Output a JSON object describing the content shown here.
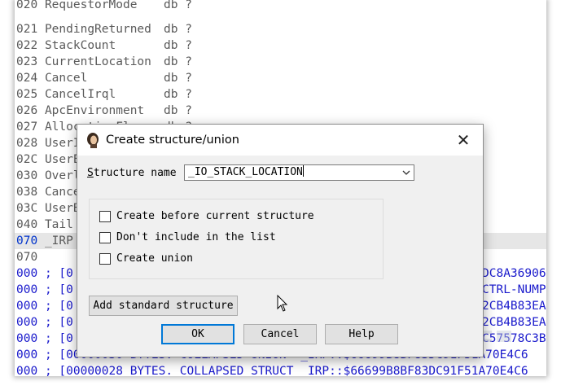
{
  "listing": {
    "lines": [
      {
        "addr": "020",
        "name": "RequestorMode",
        "type": "db ?",
        "highlight": false
      },
      {
        "addr": "021",
        "name": "PendingReturned",
        "type": "db ?",
        "highlight": false
      },
      {
        "addr": "022",
        "name": "StackCount",
        "type": "db ?",
        "highlight": false
      },
      {
        "addr": "023",
        "name": "CurrentLocation",
        "type": "db ?",
        "highlight": false
      },
      {
        "addr": "024",
        "name": "Cancel",
        "type": "db ?",
        "highlight": false
      },
      {
        "addr": "025",
        "name": "CancelIrql",
        "type": "db ?",
        "highlight": false
      },
      {
        "addr": "026",
        "name": "ApcEnvironment",
        "type": "db ?",
        "highlight": false
      },
      {
        "addr": "027",
        "name": "AllocationFlags",
        "type": "db ?",
        "highlight": false
      },
      {
        "addr": "028",
        "name": "UserIosb",
        "type": "",
        "highlight": false
      },
      {
        "addr": "02C",
        "name": "UserEvent",
        "type": "",
        "highlight": false
      },
      {
        "addr": "030",
        "name": "Overlay",
        "type": "",
        "highlight": false
      },
      {
        "addr": "038",
        "name": "CancelRoutine",
        "type": "",
        "highlight": false
      },
      {
        "addr": "03C",
        "name": "UserBuffer",
        "type": "",
        "highlight": false
      },
      {
        "addr": "040",
        "name": "Tail",
        "type": "",
        "highlight": false
      },
      {
        "addr": "070",
        "name": "_IRP",
        "type": "",
        "highlight": true
      },
      {
        "addr": "070",
        "name": "",
        "type": "",
        "highlight": false
      }
    ],
    "comments": [
      {
        "addr": "000",
        "text": "; [0",
        "tail": "DC8A36906"
      },
      {
        "addr": "000",
        "text": "; [0",
        "tail": "CTRL-NUMP"
      },
      {
        "addr": "000",
        "text": "; [0",
        "tail": "2CB4B83EA"
      },
      {
        "addr": "000",
        "text": "; [0",
        "tail": "2CB4B83EA"
      },
      {
        "addr": "000",
        "text": "; [0",
        "tail": "C57578C3B"
      },
      {
        "addr": "000",
        "text": "; [00000030 BYTES. COLLAPSED UNION  _IRP::$66699B8BF83DC91F51A70E4C6",
        "tail": ""
      },
      {
        "addr": "000",
        "text": "; [00000028 BYTES. COLLAPSED STRUCT _IRP::$66699B8BF83DC91F51A70E4C6",
        "tail": ""
      }
    ]
  },
  "dialog": {
    "title": "Create structure/union",
    "close_glyph": "✕",
    "structure_name_label_prefix": "S",
    "structure_name_label_rest": "tructure name",
    "structure_name_value": "_IO_STACK_LOCATION",
    "options": [
      {
        "label": "Create before current structure",
        "checked": false
      },
      {
        "label": "Don't include in the list",
        "checked": false
      },
      {
        "label": "Create union",
        "checked": false
      }
    ],
    "add_standard_label": "Add standard structure",
    "ok_label": "OK",
    "cancel_label": "Cancel",
    "help_label": "Help"
  },
  "icons": {
    "app": "ida-woman-icon",
    "close": "close-icon",
    "combo_arrow": "chevron-down-icon",
    "cursor": "mouse-pointer-icon"
  },
  "colors": {
    "comment_blue": "#1a1acc",
    "highlight_row": "#e6e6e6",
    "dialog_bg": "#f0f0f0",
    "ok_border": "#0078d7"
  }
}
